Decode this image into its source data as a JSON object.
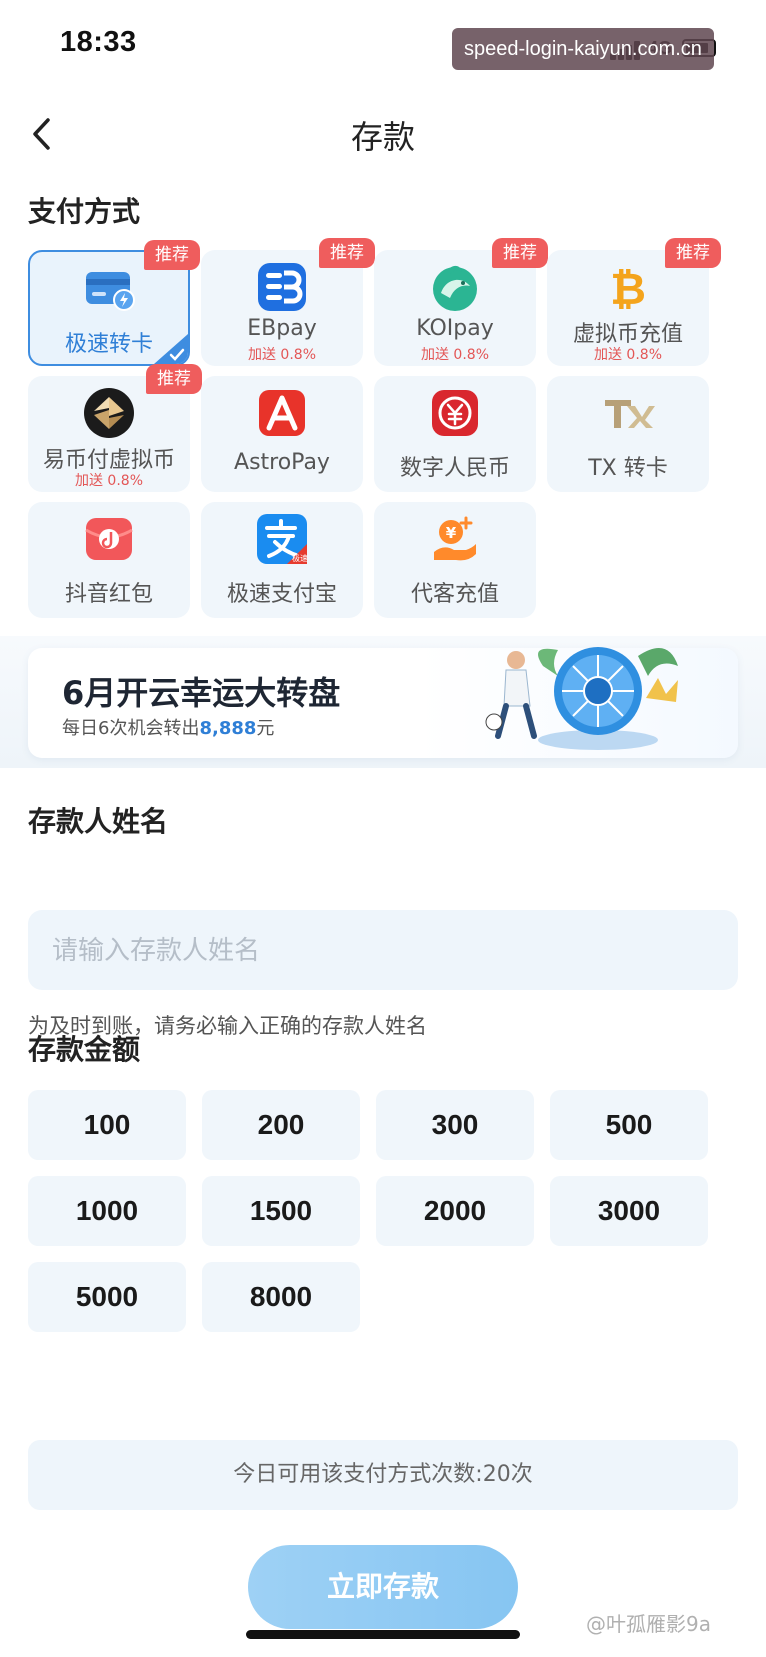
{
  "status_bar": {
    "time": "18:33",
    "network": "4G",
    "watermark_url": "speed-login-kaiyun.com.cn"
  },
  "nav": {
    "back_icon": "chevron-left-icon",
    "title": "存款"
  },
  "payment": {
    "section_title": "支付方式",
    "badge": "推荐",
    "methods": [
      {
        "label": "极速转卡",
        "icon": "bank-card-icon",
        "recommended": true,
        "selected": true
      },
      {
        "label": "EBpay",
        "icon": "ebpay-icon",
        "bonus": "加送 0.8%",
        "recommended": true
      },
      {
        "label": "KOIpay",
        "icon": "koipay-icon",
        "bonus": "加送 0.8%",
        "recommended": true
      },
      {
        "label": "虚拟币充值",
        "icon": "bitcoin-icon",
        "bonus": "加送 0.8%",
        "recommended": true
      },
      {
        "label": "易币付虚拟币",
        "icon": "yibifu-icon",
        "bonus": "加送 0.8%",
        "recommended": true
      },
      {
        "label": "AstroPay",
        "icon": "astropay-icon"
      },
      {
        "label": "数字人民币",
        "icon": "digital-rmb-icon"
      },
      {
        "label": "TX 转卡",
        "icon": "tx-logo-icon"
      },
      {
        "label": "抖音红包",
        "icon": "douyin-redpacket-icon"
      },
      {
        "label": "极速支付宝",
        "icon": "alipay-icon",
        "icon_tag": "极速"
      },
      {
        "label": "代客充值",
        "icon": "agent-recharge-icon"
      }
    ]
  },
  "banner": {
    "title": "6月开云幸运大转盘",
    "subtitle_prefix": "每日6次机会转出",
    "subtitle_amount": "8,888",
    "subtitle_suffix": "元"
  },
  "depositor": {
    "section_title": "存款人姓名",
    "placeholder": "请输入存款人姓名",
    "value": "",
    "hint": "为及时到账，请务必输入正确的存款人姓名"
  },
  "amount": {
    "section_title": "存款金额",
    "options": [
      "100",
      "200",
      "300",
      "500",
      "1000",
      "1500",
      "2000",
      "3000",
      "5000",
      "8000"
    ]
  },
  "usage_note": "今日可用该支付方式次数:20次",
  "submit_label": "立即存款",
  "author_watermark": "@叶孤雁影9a",
  "colors": {
    "accent": "#3e8de0",
    "badge": "#ef5d5d",
    "bonus": "#e35656",
    "card_bg": "#f0f6fb",
    "submit": "#8ecbf3"
  }
}
